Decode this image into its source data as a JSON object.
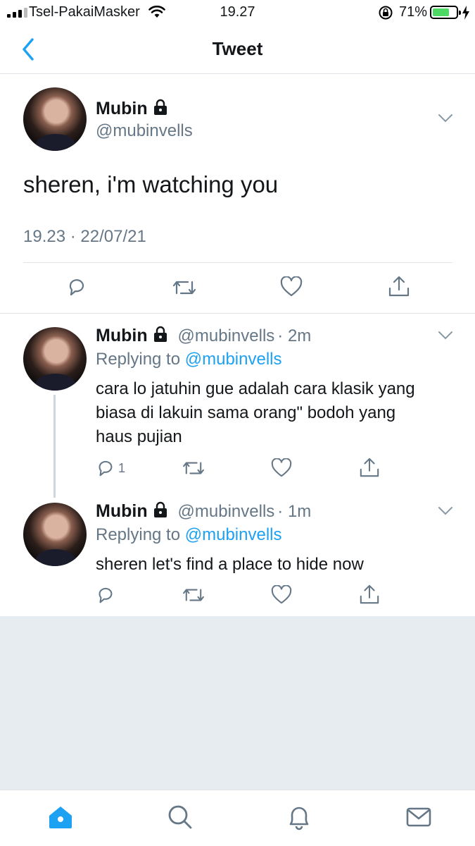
{
  "status_bar": {
    "carrier": "Tsel-PakaiMasker",
    "time": "19.27",
    "battery_percent": "71%",
    "battery_level": 0.71
  },
  "nav": {
    "title": "Tweet",
    "back_icon": "chevron-left-icon"
  },
  "main_tweet": {
    "name": "Mubin",
    "handle": "@mubinvells",
    "text": "sheren, i'm watching you",
    "timestamp": "19.23 · 22/07/21"
  },
  "replies": [
    {
      "name": "Mubin",
      "handle": "@mubinvells",
      "age": "· 2m",
      "replying_prefix": "Replying to",
      "replying_to": "@mubinvells",
      "text_lines": [
        "cara lo jatuhin gue adalah cara klasik yang",
        "biasa di lakuin sama orang\" bodoh yang",
        "haus pujian"
      ],
      "reply_count": "1"
    },
    {
      "name": "Mubin",
      "handle": "@mubinvells",
      "age": "· 1m",
      "replying_prefix": "Replying to",
      "replying_to": "@mubinvells",
      "text_lines": [
        "sheren let's find a place to hide now"
      ],
      "reply_count": ""
    }
  ],
  "colors": {
    "accent": "#1da1f2",
    "secondary_text": "#657786",
    "divider": "#dfe3e7",
    "empty_area": "#e6ecf0"
  },
  "tabs": [
    "home-icon",
    "search-icon",
    "notifications-icon",
    "messages-icon"
  ]
}
